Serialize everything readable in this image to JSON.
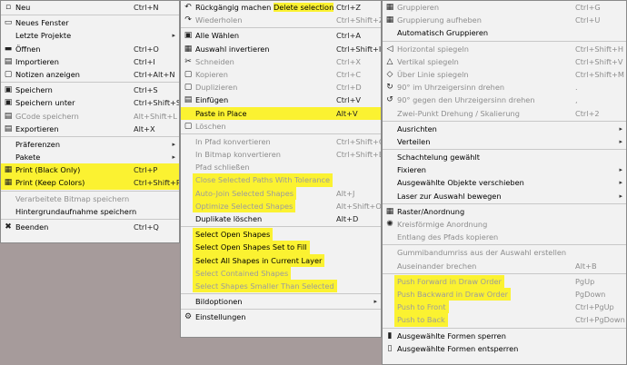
{
  "menu1": [
    {
      "label": "Neu",
      "shortcut": "Ctrl+N",
      "icon": "document-new-icon",
      "glyph": "▫"
    },
    {
      "sep": true
    },
    {
      "label": "Neues Fenster",
      "icon": "window-icon",
      "glyph": "▭"
    },
    {
      "label": "Letzte Projekte",
      "arrow": true
    },
    {
      "label": "Öffnen",
      "shortcut": "Ctrl+O",
      "icon": "folder-icon",
      "glyph": "▬"
    },
    {
      "label": "Importieren",
      "shortcut": "Ctrl+I",
      "icon": "import-icon",
      "glyph": "▤"
    },
    {
      "label": "Notizen anzeigen",
      "shortcut": "Ctrl+Alt+N",
      "icon": "notes-icon",
      "glyph": "▢"
    },
    {
      "sep": true
    },
    {
      "label": "Speichern",
      "shortcut": "Ctrl+S",
      "icon": "save-icon",
      "glyph": "▣"
    },
    {
      "label": "Speichern unter",
      "shortcut": "Ctrl+Shift+S",
      "icon": "save-as-icon",
      "glyph": "▣"
    },
    {
      "label": "GCode speichern",
      "shortcut": "Alt+Shift+L",
      "icon": "gcode-icon",
      "glyph": "▤",
      "disabled": true
    },
    {
      "label": "Exportieren",
      "shortcut": "Alt+X",
      "icon": "export-icon",
      "glyph": "▤"
    },
    {
      "sep": true
    },
    {
      "label": "Präferenzen",
      "arrow": true
    },
    {
      "label": "Pakete",
      "arrow": true
    },
    {
      "label": "Print (Black Only)",
      "shortcut": "Ctrl+P",
      "icon": "printer-icon",
      "glyph": "▦",
      "rowhl": true
    },
    {
      "label": "Print (Keep Colors)",
      "shortcut": "Ctrl+Shift+P",
      "icon": "printer-icon",
      "glyph": "▦",
      "rowhl": true
    },
    {
      "sep": true
    },
    {
      "label": "Verarbeitete Bitmap speichern",
      "disabled": true
    },
    {
      "label": "Hintergrundaufnahme speichern"
    },
    {
      "sep": true
    },
    {
      "label": "Beenden",
      "shortcut": "Ctrl+Q",
      "icon": "quit-icon",
      "glyph": "✖"
    }
  ],
  "menu2": [
    {
      "label": "Rückgängig machen Delete selection",
      "shortcut": "Ctrl+Z",
      "icon": "undo-icon",
      "glyph": "↶",
      "hl_part": "Delete selection"
    },
    {
      "label": "Wiederholen",
      "shortcut": "Ctrl+Shift+Z",
      "icon": "redo-icon",
      "glyph": "↷",
      "disabled": true
    },
    {
      "sep": true
    },
    {
      "label": "Alle Wählen",
      "shortcut": "Ctrl+A",
      "icon": "select-all-icon",
      "glyph": "▣"
    },
    {
      "label": "Auswahl invertieren",
      "shortcut": "Ctrl+Shift+I",
      "icon": "invert-selection-icon",
      "glyph": "▦"
    },
    {
      "label": "Schneiden",
      "shortcut": "Ctrl+X",
      "icon": "cut-icon",
      "glyph": "✂",
      "disabled": true
    },
    {
      "label": "Kopieren",
      "shortcut": "Ctrl+C",
      "icon": "copy-icon",
      "glyph": "▢",
      "disabled": true
    },
    {
      "label": "Duplizieren",
      "shortcut": "Ctrl+D",
      "icon": "duplicate-icon",
      "glyph": "▢",
      "disabled": true
    },
    {
      "label": "Einfügen",
      "shortcut": "Ctrl+V",
      "icon": "paste-icon",
      "glyph": "▤"
    },
    {
      "label": "Paste in Place",
      "shortcut": "Alt+V",
      "rowhl": true
    },
    {
      "label": "Löschen",
      "icon": "delete-icon",
      "glyph": "▢",
      "disabled": true
    },
    {
      "sep": true
    },
    {
      "label": "In Pfad konvertieren",
      "shortcut": "Ctrl+Shift+C",
      "disabled": true
    },
    {
      "label": "In Bitmap konvertieren",
      "shortcut": "Ctrl+Shift+B",
      "disabled": true
    },
    {
      "label": "Pfad schließen",
      "disabled": true
    },
    {
      "label": "Close Selected Paths With Tolerance",
      "disabled": true,
      "hl": true
    },
    {
      "label": "Auto-Join Selected Shapes",
      "shortcut": "Alt+J",
      "disabled": true,
      "hl": true
    },
    {
      "label": "Optimize Selected Shapes",
      "shortcut": "Alt+Shift+O",
      "disabled": true,
      "hl": true
    },
    {
      "label": "Duplikate löschen",
      "shortcut": "Alt+D"
    },
    {
      "sep": true
    },
    {
      "label": "Select Open Shapes",
      "hl": true
    },
    {
      "label": "Select Open Shapes Set to Fill",
      "hl": true
    },
    {
      "label": "Select All Shapes in Current Layer",
      "hl": true
    },
    {
      "label": "Select Contained Shapes",
      "disabled": true,
      "hl": true
    },
    {
      "label": "Select Shapes Smaller Than Selected",
      "disabled": true,
      "hl": true
    },
    {
      "sep": true
    },
    {
      "label": "Bildoptionen",
      "arrow": true
    },
    {
      "sep": true
    },
    {
      "label": "Einstellungen",
      "icon": "settings-icon",
      "glyph": "⚙"
    }
  ],
  "menu3": [
    {
      "label": "Gruppieren",
      "shortcut": "Ctrl+G",
      "icon": "group-icon",
      "glyph": "▦",
      "disabled": true
    },
    {
      "label": "Gruppierung aufheben",
      "shortcut": "Ctrl+U",
      "icon": "ungroup-icon",
      "glyph": "▦",
      "disabled": true
    },
    {
      "label": "Automatisch Gruppieren"
    },
    {
      "sep": true
    },
    {
      "label": "Horizontal spiegeln",
      "shortcut": "Ctrl+Shift+H",
      "icon": "flip-horizontal-icon",
      "glyph": "◁",
      "disabled": true
    },
    {
      "label": "Vertikal spiegeln",
      "shortcut": "Ctrl+Shift+V",
      "icon": "flip-vertical-icon",
      "glyph": "△",
      "disabled": true
    },
    {
      "label": "Über Linie spiegeln",
      "shortcut": "Ctrl+Shift+M",
      "icon": "mirror-line-icon",
      "glyph": "◇",
      "disabled": true
    },
    {
      "label": "90° im Uhrzeigersinn drehen",
      "shortcut": ".",
      "icon": "rotate-cw-icon",
      "glyph": "↻",
      "disabled": true
    },
    {
      "label": "90° gegen den Uhrzeigersinn drehen",
      "shortcut": ",",
      "icon": "rotate-ccw-icon",
      "glyph": "↺",
      "disabled": true
    },
    {
      "label": "Zwei-Punkt Drehung / Skalierung",
      "shortcut": "Ctrl+2",
      "disabled": true
    },
    {
      "sep": true
    },
    {
      "label": "Ausrichten",
      "arrow": true
    },
    {
      "label": "Verteilen",
      "arrow": true
    },
    {
      "sep": true
    },
    {
      "label": "Schachtelung gewählt"
    },
    {
      "label": "Fixieren",
      "arrow": true
    },
    {
      "label": "Ausgewählte Objekte verschieben",
      "arrow": true
    },
    {
      "label": "Laser zur Auswahl bewegen",
      "arrow": true
    },
    {
      "sep": true
    },
    {
      "label": "Raster/Anordnung",
      "icon": "grid-icon",
      "glyph": "▦"
    },
    {
      "label": "Kreisförmige Anordnung",
      "icon": "circular-array-icon",
      "glyph": "✺",
      "disabled": true
    },
    {
      "label": "Entlang des Pfads kopieren",
      "disabled": true
    },
    {
      "sep": true
    },
    {
      "label": "Gummibandumriss aus der Auswahl erstellen",
      "disabled": true
    },
    {
      "label": "Auseinander brechen",
      "shortcut": "Alt+B",
      "disabled": true
    },
    {
      "sep": true
    },
    {
      "label": "Push Forward in Draw Order",
      "shortcut": "PgUp",
      "disabled": true,
      "hl": true
    },
    {
      "label": "Push Backward in Draw Order",
      "shortcut": "PgDown",
      "disabled": true,
      "hl": true
    },
    {
      "label": "Push to Front",
      "shortcut": "Ctrl+PgUp",
      "disabled": true,
      "hl": true
    },
    {
      "label": "Push to Back",
      "shortcut": "Ctrl+PgDown",
      "disabled": true,
      "hl": true
    },
    {
      "sep": true
    },
    {
      "label": "Ausgewählte Formen sperren",
      "icon": "lock-icon",
      "glyph": "▮"
    },
    {
      "label": "Ausgewählte Formen entsperren",
      "icon": "unlock-icon",
      "glyph": "▯"
    }
  ]
}
